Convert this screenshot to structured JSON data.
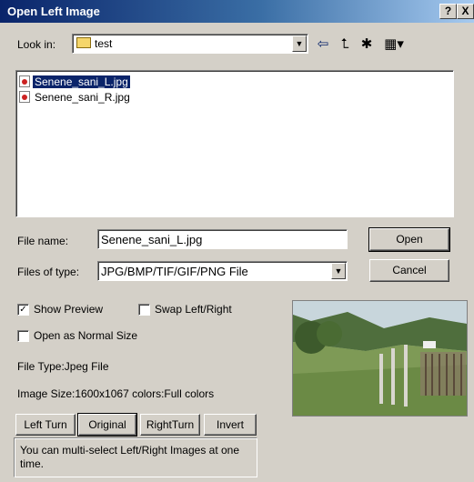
{
  "window": {
    "title": "Open Left Image",
    "help_button": "?",
    "close_button": "X"
  },
  "look_in": {
    "label": "Look in:",
    "value": "test"
  },
  "files": [
    {
      "name": "Senene_sani_L.jpg",
      "selected": true
    },
    {
      "name": "Senene_sani_R.jpg",
      "selected": false
    }
  ],
  "file_name": {
    "label": "File name:",
    "value": "Senene_sani_L.jpg"
  },
  "files_of_type": {
    "label": "Files of type:",
    "value": "JPG/BMP/TIF/GIF/PNG File"
  },
  "buttons": {
    "open": "Open",
    "cancel": "Cancel",
    "left_turn": "Left Turn",
    "original": "Original",
    "right_turn": "RightTurn",
    "invert": "Invert"
  },
  "options": {
    "show_preview": {
      "label": "Show Preview",
      "checked": true
    },
    "swap_left_right": {
      "label": "Swap Left/Right",
      "checked": false
    },
    "open_normal_size": {
      "label": "Open as Normal Size",
      "checked": false
    }
  },
  "info": {
    "file_type": "File Type:Jpeg File",
    "image_size": "Image Size:1600x1067  colors:Full colors",
    "hint": "You can multi-select Left/Right Images at one time."
  },
  "colors": {
    "title_start": "#0a246a",
    "title_end": "#a6caf0",
    "face": "#d4d0c8",
    "selection": "#0a246a"
  }
}
